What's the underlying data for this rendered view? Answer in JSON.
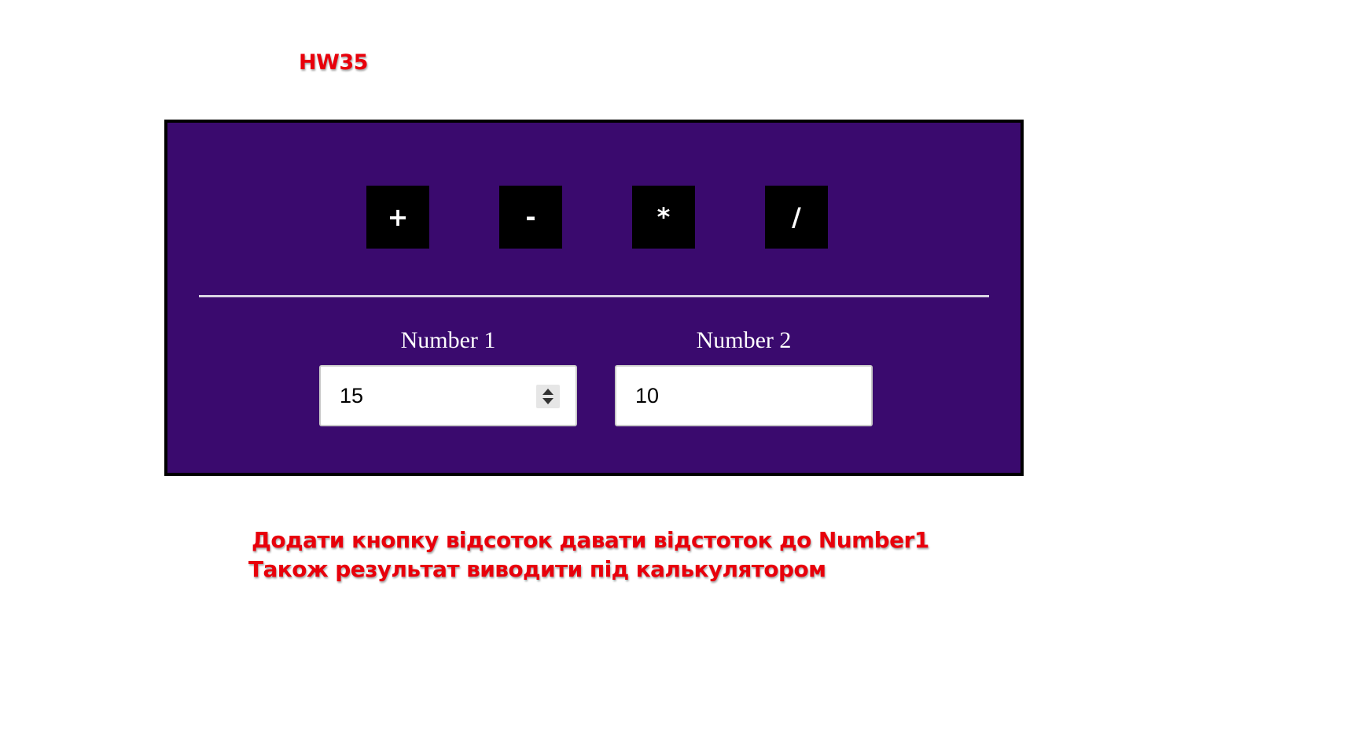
{
  "header": {
    "title": "HW35"
  },
  "calculator": {
    "background_color": "#3a0a6e",
    "operations": [
      {
        "label": "+"
      },
      {
        "label": "-"
      },
      {
        "label": "*"
      },
      {
        "label": "/"
      }
    ],
    "number1": {
      "label": "Number 1",
      "value": "15"
    },
    "number2": {
      "label": "Number 2",
      "value": "10"
    }
  },
  "task": {
    "line1": "Додати кнопку відсоток давати відстоток до Number1",
    "line2": "Також результат виводити під калькулятором",
    "color": "#e8000b"
  }
}
